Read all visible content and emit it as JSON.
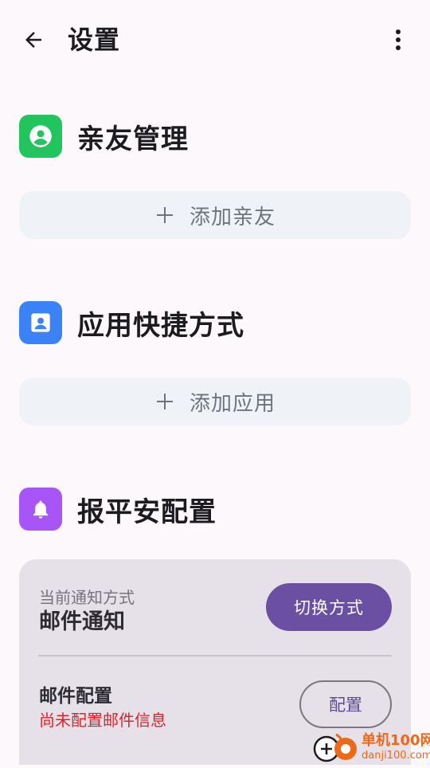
{
  "appbar": {
    "title": "设置",
    "back_icon": "arrow-back-icon",
    "more_icon": "more-vert-icon"
  },
  "sections": {
    "contacts": {
      "title": "亲友管理",
      "icon": "account-circle-icon",
      "icon_color": "#22c45e",
      "add_label": "添加亲友"
    },
    "apps": {
      "title": "应用快捷方式",
      "icon": "contact-portrait-icon",
      "icon_color": "#3b82f6",
      "add_label": "添加应用"
    },
    "safety": {
      "title": "报平安配置",
      "icon": "bell-icon",
      "icon_color": "#a855f7"
    }
  },
  "notify_card": {
    "current_caption": "当前通知方式",
    "current_value": "邮件通知",
    "switch_label": "切换方式",
    "mail_title": "邮件配置",
    "mail_status": "尚未配置邮件信息",
    "config_label": "配置"
  },
  "watermark": {
    "name": "单机100网",
    "url": "danji100.com"
  },
  "colors": {
    "background": "#fcf8fc",
    "add_button_bg": "#eff3f7",
    "card_bg": "#e6e0e9",
    "primary": "#6b4fa2",
    "error": "#d8262b"
  }
}
